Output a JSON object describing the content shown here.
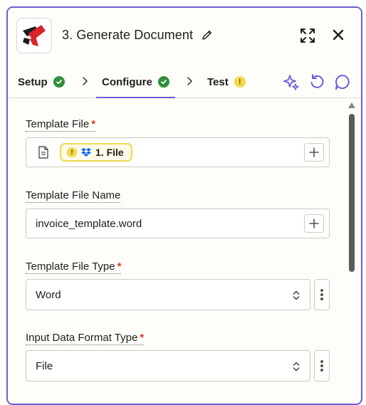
{
  "step": {
    "title": "3. Generate Document"
  },
  "tabs": [
    {
      "label": "Setup",
      "status": "complete"
    },
    {
      "label": "Configure",
      "status": "complete",
      "active": true
    },
    {
      "label": "Test",
      "status": "warning"
    }
  ],
  "fields": {
    "template_file": {
      "label": "Template File",
      "required_mark": "*",
      "pill": {
        "warning_glyph": "!",
        "text": "1. File",
        "source_icon": "dropbox-icon"
      }
    },
    "template_file_name": {
      "label": "Template File Name",
      "value": "invoice_template.word"
    },
    "template_file_type": {
      "label": "Template File Type",
      "required_mark": "*",
      "value": "Word"
    },
    "input_data_format_type": {
      "label": "Input Data Format Type",
      "required_mark": "*",
      "value": "File"
    }
  },
  "colors": {
    "accent": "#6c5fd3",
    "success": "#2f8f3a",
    "warning": "#f2d94e",
    "required": "#d93a23"
  }
}
